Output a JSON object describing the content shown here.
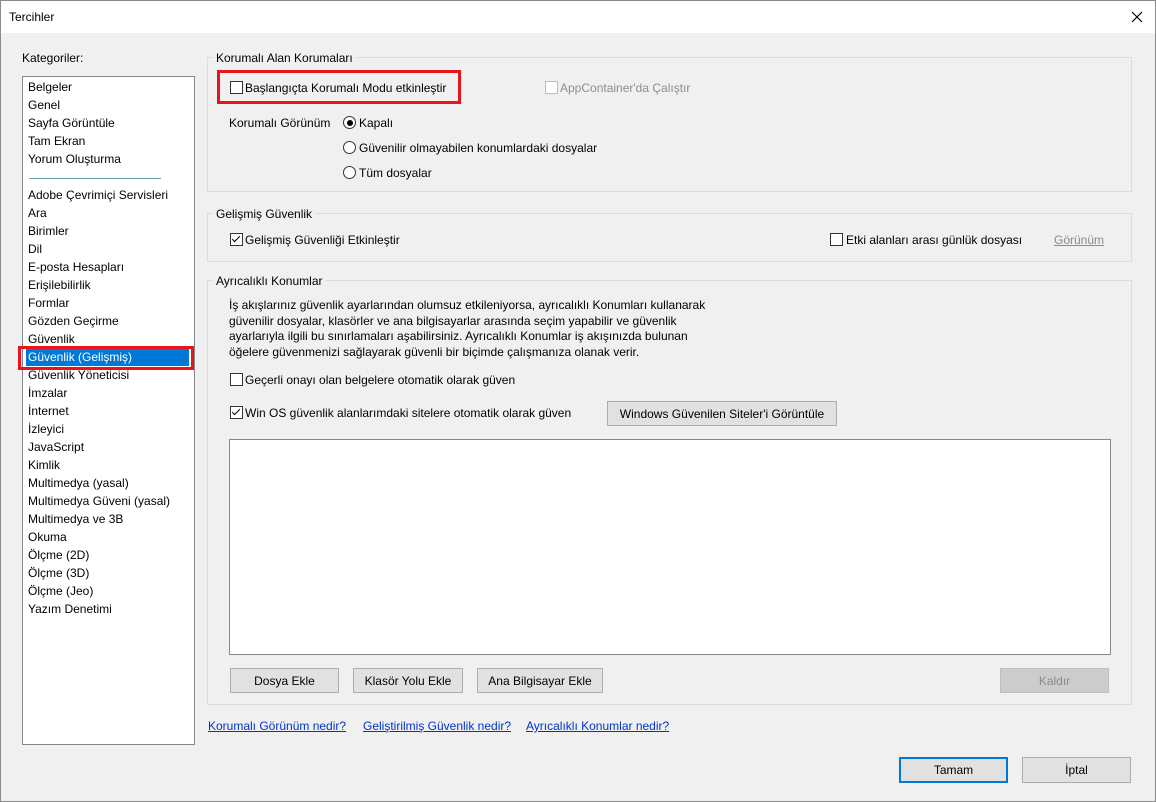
{
  "window": {
    "title": "Tercihler",
    "close_icon": "close-icon"
  },
  "categories": {
    "label": "Kategoriler:",
    "group1": [
      "Belgeler",
      "Genel",
      "Sayfa Görüntüle",
      "Tam Ekran",
      "Yorum Oluşturma"
    ],
    "group2": [
      "Adobe Çevrimiçi Servisleri",
      "Ara",
      "Birimler",
      "Dil",
      "E-posta Hesapları",
      "Erişilebilirlik",
      "Formlar",
      "Gözden Geçirme",
      "Güvenlik",
      "Güvenlik (Gelişmiş)",
      "Güvenlik Yöneticisi",
      "İmzalar",
      "İnternet",
      "İzleyici",
      "JavaScript",
      "Kimlik",
      "Multimedya (yasal)",
      "Multimedya Güveni (yasal)",
      "Multimedya ve 3B",
      "Okuma",
      "Ölçme (2D)",
      "Ölçme (3D)",
      "Ölçme (Jeo)",
      "Yazım Denetimi"
    ],
    "selected": "Güvenlik (Gelişmiş)"
  },
  "sandbox": {
    "title": "Korumalı Alan Korumaları",
    "enable_on_startup": "Başlangıçta Korumalı Modu etkinleştir",
    "enable_on_startup_checked": false,
    "app_container": "AppContainer'da Çalıştır",
    "app_container_checked": false,
    "protected_view_label": "Korumalı Görünüm",
    "options": [
      "Kapalı",
      "Güvenilir olmayabilen konumlardaki dosyalar",
      "Tüm dosyalar"
    ],
    "selected_option": "Kapalı"
  },
  "enhanced": {
    "title": "Gelişmiş Güvenlik",
    "enable": "Gelişmiş Güvenliği Etkinleştir",
    "enable_checked": true,
    "cross_domain_log": "Etki alanları arası günlük dosyası",
    "cross_domain_log_checked": false,
    "view_link": "Görünüm"
  },
  "privileged": {
    "title": "Ayrıcalıklı Konumlar",
    "description": [
      "İş akışlarınız güvenlik ayarlarından olumsuz etkileniyorsa, ayrıcalıklı Konumları kullanarak",
      "güvenilir dosyalar, klasörler ve ana bilgisayarlar arasında seçim yapabilir ve güvenlik",
      "ayarlarıyla ilgili bu sınırlamaları aşabilirsiniz. Ayrıcalıklı Konumlar iş akışınızda bulunan",
      "öğelere güvenmenizi sağlayarak güvenli bir biçimde çalışmanıza olanak verir."
    ],
    "trust_certified": "Geçerli onayı olan belgelere otomatik olarak güven",
    "trust_certified_checked": false,
    "trust_win_sites": "Win OS güvenlik alanlarımdaki sitelere otomatik olarak güven",
    "trust_win_sites_checked": true,
    "view_trusted_sites_button": "Windows Güvenilen Siteler'i Görüntüle",
    "add_file_button": "Dosya Ekle",
    "add_folder_button": "Klasör Yolu Ekle",
    "add_host_button": "Ana Bilgisayar Ekle",
    "remove_button": "Kaldır"
  },
  "links": {
    "protected_view_help": "Korumalı Görünüm nedir?",
    "enhanced_help": "Geliştirilmiş Güvenlik nedir?",
    "privileged_help": "Ayrıcalıklı Konumlar nedir?"
  },
  "footer": {
    "ok": "Tamam",
    "cancel": "İptal"
  },
  "colors": {
    "selection": "#0078d7",
    "highlight": "#e8141c",
    "link": "#0033cc"
  }
}
